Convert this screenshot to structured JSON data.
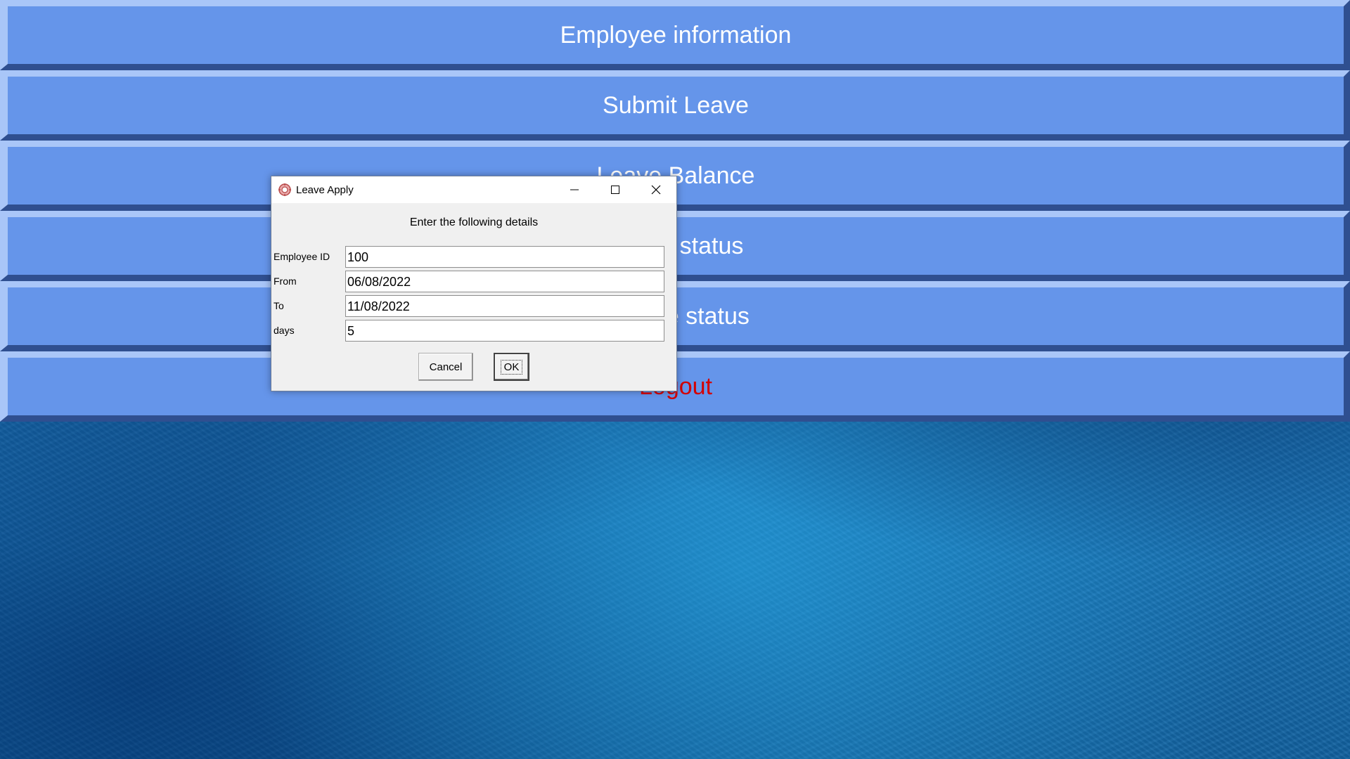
{
  "menu": {
    "items": [
      {
        "label": "Employee information"
      },
      {
        "label": "Submit Leave"
      },
      {
        "label": "Leave Balance"
      },
      {
        "label": "Leave status"
      },
      {
        "label": "Update status"
      },
      {
        "label": "Logout"
      }
    ],
    "logout_color": "#d40000"
  },
  "dialog": {
    "title": "Leave Apply",
    "instruction": "Enter the following details",
    "fields": [
      {
        "label": "Employee ID",
        "value": "100"
      },
      {
        "label": "From",
        "value": "06/08/2022"
      },
      {
        "label": "To",
        "value": "11/08/2022"
      },
      {
        "label": "days",
        "value": "5"
      }
    ],
    "cancel_label": "Cancel",
    "ok_label": "OK",
    "icons": {
      "app": "app-icon",
      "minimize": "minimize-icon",
      "maximize": "maximize-icon",
      "close": "close-icon"
    }
  },
  "colors": {
    "button_face": "#6595ea",
    "background": "#1a79bf"
  }
}
